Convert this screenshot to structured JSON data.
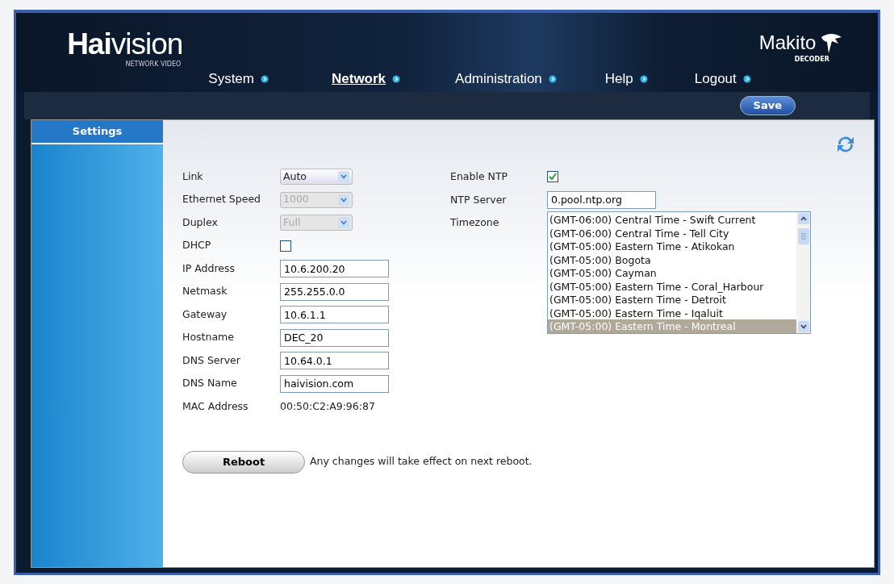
{
  "brand": {
    "logo": "**Hai**vision",
    "tagline": "NETWORK VIDEO",
    "product": "Makito",
    "product_sub": "DECODER"
  },
  "nav": [
    {
      "label": "System",
      "selected": false
    },
    {
      "label": "Network",
      "selected": true
    },
    {
      "label": "Administration",
      "selected": false
    },
    {
      "label": "Help",
      "selected": false
    },
    {
      "label": "Logout",
      "selected": false
    }
  ],
  "save_button": "Save",
  "sidebar": {
    "items": [
      {
        "label": "Settings",
        "selected": true
      }
    ]
  },
  "left_fields": [
    {
      "kind": "select",
      "label": "Link",
      "value": "Auto",
      "disabled": false
    },
    {
      "kind": "select",
      "label": "Ethernet Speed",
      "value": "1000",
      "disabled": true
    },
    {
      "kind": "select",
      "label": "Duplex",
      "value": "Full",
      "disabled": true
    },
    {
      "kind": "checkbox",
      "label": "DHCP",
      "checked": false
    },
    {
      "kind": "text",
      "label": "IP Address",
      "value": "10.6.200.20"
    },
    {
      "kind": "text",
      "label": "Netmask",
      "value": "255.255.0.0"
    },
    {
      "kind": "text",
      "label": "Gateway",
      "value": "10.6.1.1"
    },
    {
      "kind": "text",
      "label": "Hostname",
      "value": "DEC_20"
    },
    {
      "kind": "text",
      "label": "DNS Server",
      "value": "10.64.0.1"
    },
    {
      "kind": "text",
      "label": "DNS Name",
      "value": "haivision.com"
    },
    {
      "kind": "static",
      "label": "MAC Address",
      "value": "00:50:C2:A9:96:87"
    }
  ],
  "right_fields": [
    {
      "kind": "checkbox",
      "label": "Enable NTP",
      "checked": true
    },
    {
      "kind": "text",
      "label": "NTP Server",
      "value": "0.pool.ntp.org"
    },
    {
      "kind": "list",
      "label": "Timezone",
      "options": [
        {
          "label": "(GMT-06:00) Central Time - Swift Current",
          "selected": false
        },
        {
          "label": "(GMT-06:00) Central Time - Tell City",
          "selected": false
        },
        {
          "label": "(GMT-05:00) Eastern Time - Atikokan",
          "selected": false
        },
        {
          "label": "(GMT-05:00) Bogota",
          "selected": false
        },
        {
          "label": "(GMT-05:00) Cayman",
          "selected": false
        },
        {
          "label": "(GMT-05:00) Eastern Time - Coral_Harbour",
          "selected": false
        },
        {
          "label": "(GMT-05:00) Eastern Time - Detroit",
          "selected": false
        },
        {
          "label": "(GMT-05:00) Eastern Time - Iqaluit",
          "selected": false
        },
        {
          "label": "(GMT-05:00) Eastern Time - Montreal",
          "selected": true
        }
      ]
    }
  ],
  "reboot": {
    "button": "Reboot",
    "note": "Any changes will take effect on next reboot."
  }
}
